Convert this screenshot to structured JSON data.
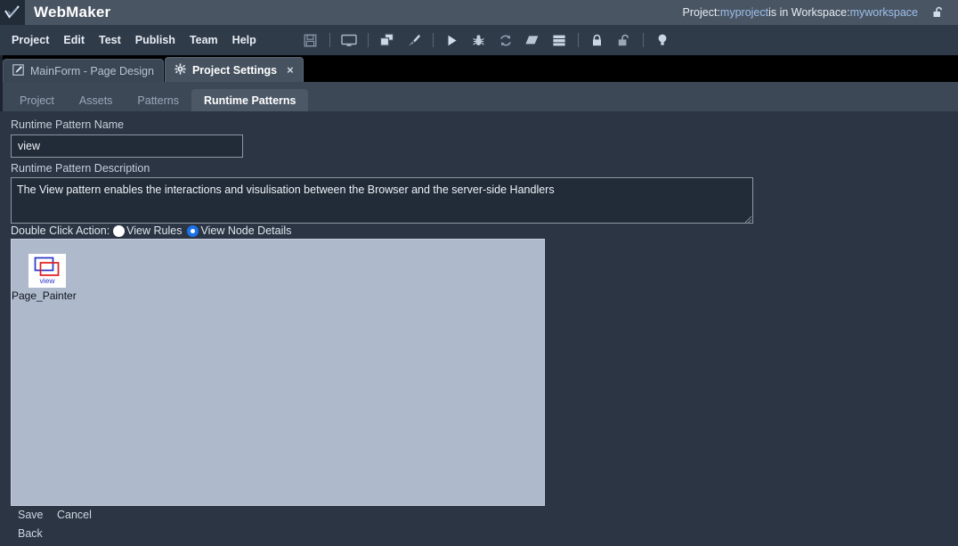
{
  "window": {
    "app_title": "WebMaker",
    "logo_icon": "checkmark-logo-icon"
  },
  "titlebar_status": {
    "prefix": "Project: ",
    "project_name": "myproject",
    "middle": " is in Workspace: ",
    "workspace_name": "myworkspace",
    "lock_icon": "unlock-icon"
  },
  "menubar": {
    "items": [
      {
        "label": "Project"
      },
      {
        "label": "Edit"
      },
      {
        "label": "Test"
      },
      {
        "label": "Publish"
      },
      {
        "label": "Team"
      },
      {
        "label": "Help"
      }
    ],
    "toolbar": [
      {
        "name": "save-icon"
      },
      {
        "name": "separator"
      },
      {
        "name": "monitor-icon"
      },
      {
        "name": "separator"
      },
      {
        "name": "windows-copy-icon"
      },
      {
        "name": "paintbrush-icon"
      },
      {
        "name": "separator"
      },
      {
        "name": "play-icon"
      },
      {
        "name": "bug-icon"
      },
      {
        "name": "refresh-icon"
      },
      {
        "name": "eraser-icon"
      },
      {
        "name": "database-icon"
      },
      {
        "name": "separator"
      },
      {
        "name": "lock-closed-icon"
      },
      {
        "name": "lock-open-icon"
      },
      {
        "name": "separator"
      },
      {
        "name": "lightbulb-icon"
      }
    ]
  },
  "tabs": [
    {
      "label": "MainForm - Page Design",
      "icon": "pencil-edit-icon",
      "active": false,
      "closable": false
    },
    {
      "label": "Project Settings",
      "icon": "gear-icon",
      "active": true,
      "closable": true,
      "close_glyph": "×"
    }
  ],
  "subtabs": [
    {
      "label": "Project",
      "active": false
    },
    {
      "label": "Assets",
      "active": false
    },
    {
      "label": "Patterns",
      "active": false
    },
    {
      "label": "Runtime Patterns",
      "active": true
    }
  ],
  "form": {
    "name_label": "Runtime Pattern Name",
    "name_value": "view",
    "name_placeholder": "",
    "description_label": "Runtime Pattern Description",
    "description_value": "The View pattern enables the interactions and visulisation between the Browser and the server-side Handlers",
    "description_placeholder": "",
    "double_click_label": "Double Click Action:",
    "radio_options": [
      {
        "label": "View Rules",
        "selected": false
      },
      {
        "label": "View Node Details",
        "selected": true
      }
    ]
  },
  "canvas": {
    "nodes": [
      {
        "label": "Page_Painter",
        "icon_caption": "view",
        "icon_name": "view-pattern-node-icon",
        "icon_colors": {
          "rect_back": "#2a35c8",
          "rect_front": "#e01b1b",
          "caption": "#2a35c8"
        }
      }
    ]
  },
  "actions": {
    "save_label": "Save",
    "cancel_label": "Cancel",
    "back_label": "Back"
  },
  "colors": {
    "titlebar": "#4a5564",
    "menubar": "#303b4a",
    "tabstrip": "#000000",
    "subtabbar": "#3d4857",
    "content_bg": "#2b3543",
    "canvas_bg": "#aeb9cb",
    "input_bg": "#222b38",
    "accent_blue": "#1a73e8",
    "link_blue": "#9dc0e8"
  }
}
